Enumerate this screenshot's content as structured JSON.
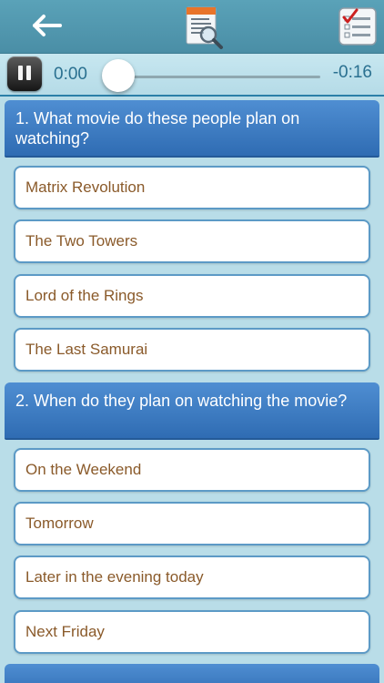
{
  "nav": {
    "back_icon": "back-arrow-icon",
    "transcript_icon": "document-search-icon",
    "quiz_icon": "checklist-icon"
  },
  "player": {
    "state": "playing",
    "elapsed": "0:00",
    "remaining": "-0:16",
    "progress": 0
  },
  "questions": [
    {
      "text": "1. What movie do these people plan on watching?",
      "answers": [
        "Matrix Revolution",
        "The Two Towers",
        "Lord of the Rings",
        "The Last Samurai"
      ]
    },
    {
      "text": "2. When do they plan on watching the movie?",
      "answers": [
        "On the Weekend",
        "Tomorrow",
        "Later in the evening today",
        "Next Friday"
      ]
    }
  ],
  "colors": {
    "background": "#b9dde8",
    "header": "#4a8ea6",
    "question": "#3a7bc4",
    "answer_text": "#8a5a2a",
    "time_text": "#2a7090"
  }
}
